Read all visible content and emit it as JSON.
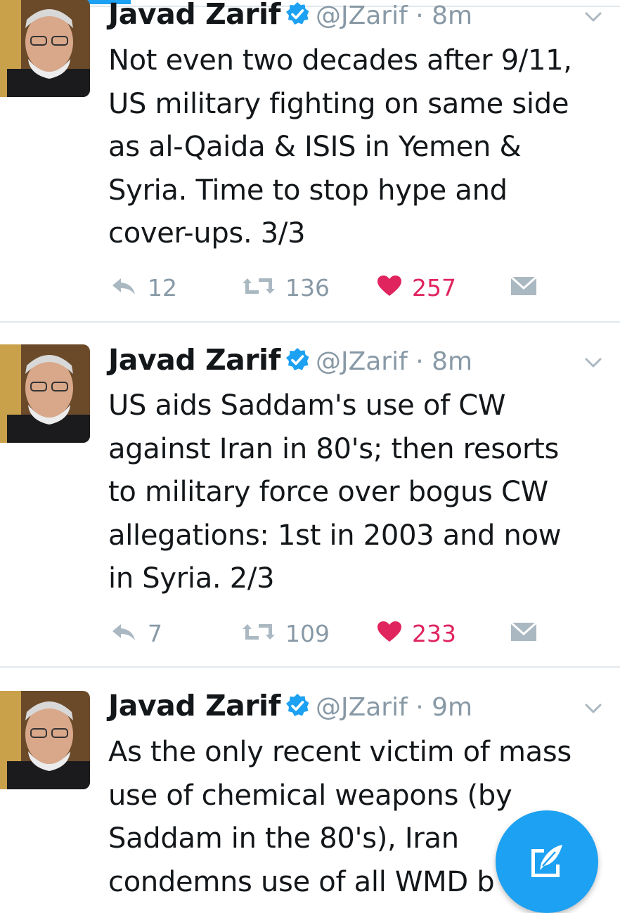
{
  "colors": {
    "accent": "#1da1f2",
    "meta_gray": "#8899a6",
    "like_red": "#e0245e",
    "text": "#14171a",
    "divider": "#e1e8ed"
  },
  "tweets": [
    {
      "author": "Javad Zarif",
      "handle": "@JZarif",
      "separator": "·",
      "time": "8m",
      "lines": [
        "Not even two decades after 9/11,",
        "US military fighting on same side",
        "as al-Qaida & ISIS in Yemen &",
        "Syria. Time to stop hype and",
        "cover-ups. 3/3"
      ],
      "replies": "12",
      "retweets": "136",
      "likes": "257"
    },
    {
      "author": "Javad Zarif",
      "handle": "@JZarif",
      "separator": "·",
      "time": "8m",
      "lines": [
        "US aids Saddam's use of CW",
        "against Iran in 80's; then resorts",
        "to military force over bogus CW",
        "allegations: 1st in 2003 and now",
        "in Syria. 2/3"
      ],
      "replies": "7",
      "retweets": "109",
      "likes": "233"
    },
    {
      "author": "Javad Zarif",
      "handle": "@JZarif",
      "separator": "·",
      "time": "9m",
      "lines": [
        "As the only recent victim of mass",
        "use of chemical weapons (by",
        "Saddam in the 80's), Iran",
        "condemns use of all WMD b"
      ]
    }
  ],
  "icons": {
    "reply": "reply-icon",
    "retweet": "retweet-icon",
    "like": "heart-icon",
    "message": "envelope-icon",
    "verified": "verified-badge-icon",
    "more": "chevron-down-icon",
    "compose": "compose-tweet-icon"
  }
}
